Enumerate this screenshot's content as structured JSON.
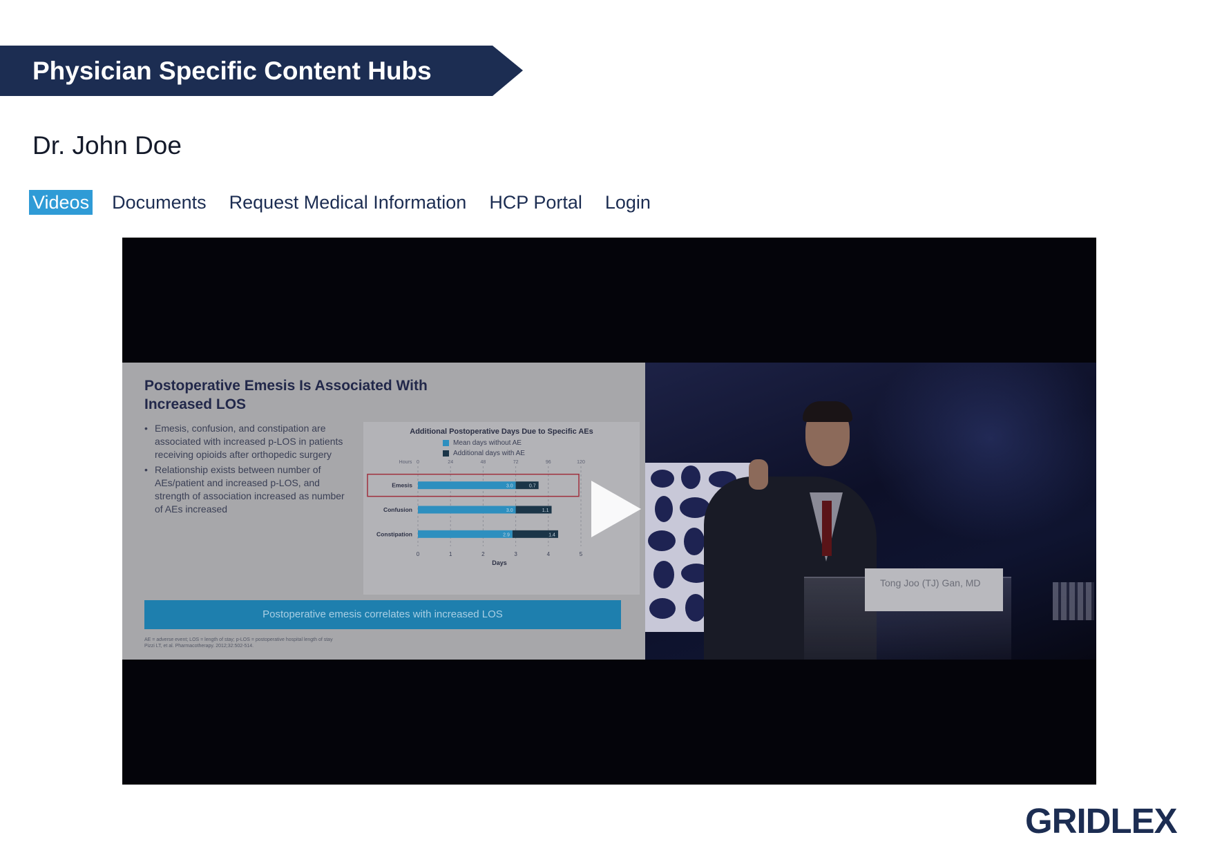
{
  "banner": {
    "title": "Physician Specific Content Hubs"
  },
  "doctor": {
    "name": "Dr. John Doe"
  },
  "nav": {
    "items": [
      {
        "label": "Videos",
        "active": true
      },
      {
        "label": "Documents"
      },
      {
        "label": "Request Medical Information"
      },
      {
        "label": "HCP Portal"
      },
      {
        "label": "Login"
      }
    ]
  },
  "video": {
    "slide": {
      "title": "Postoperative Emesis Is Associated With Increased LOS",
      "bullets": [
        "Emesis, confusion, and constipation are associated with increased p-LOS in patients receiving opioids after orthopedic surgery",
        "Relationship exists between number of AEs/patient and increased p-LOS, and strength of association increased as number of AEs increased"
      ],
      "callout": "Postoperative emesis correlates with increased LOS",
      "footnote_line1": "AE = adverse event; LOS = length of stay; p-LOS = postoperative hospital length of stay",
      "footnote_line2": "Pizzi LT, et al. Pharmacotherapy. 2012;32:502-514."
    },
    "nameplate": "Tong Joo (TJ) Gan, MD"
  },
  "chart_data": {
    "type": "bar",
    "title": "Additional Postoperative Days Due to Specific AEs",
    "categories": [
      "Emesis",
      "Confusion",
      "Constipation"
    ],
    "series": [
      {
        "name": "Mean days without AE",
        "values": [
          3.0,
          3.0,
          2.9
        ],
        "color": "#2d8fbf"
      },
      {
        "name": "Additional days with AE",
        "values": [
          0.7,
          1.1,
          1.4
        ],
        "color": "#1b3548"
      }
    ],
    "xlabel": "Days",
    "xlim": [
      0,
      5
    ],
    "xticks": [
      "0",
      "1",
      "2",
      "3",
      "4",
      "5"
    ],
    "secondary_axis_label": "Hours",
    "secondary_ticks": [
      "0",
      "24",
      "48",
      "72",
      "96",
      "120"
    ],
    "highlighted_category": "Emesis",
    "legend_position": "top",
    "grid": true
  },
  "logo": {
    "text": "GRIDLEX"
  },
  "colors": {
    "brand_navy": "#1c2d52",
    "accent_blue": "#2f9bd6"
  }
}
